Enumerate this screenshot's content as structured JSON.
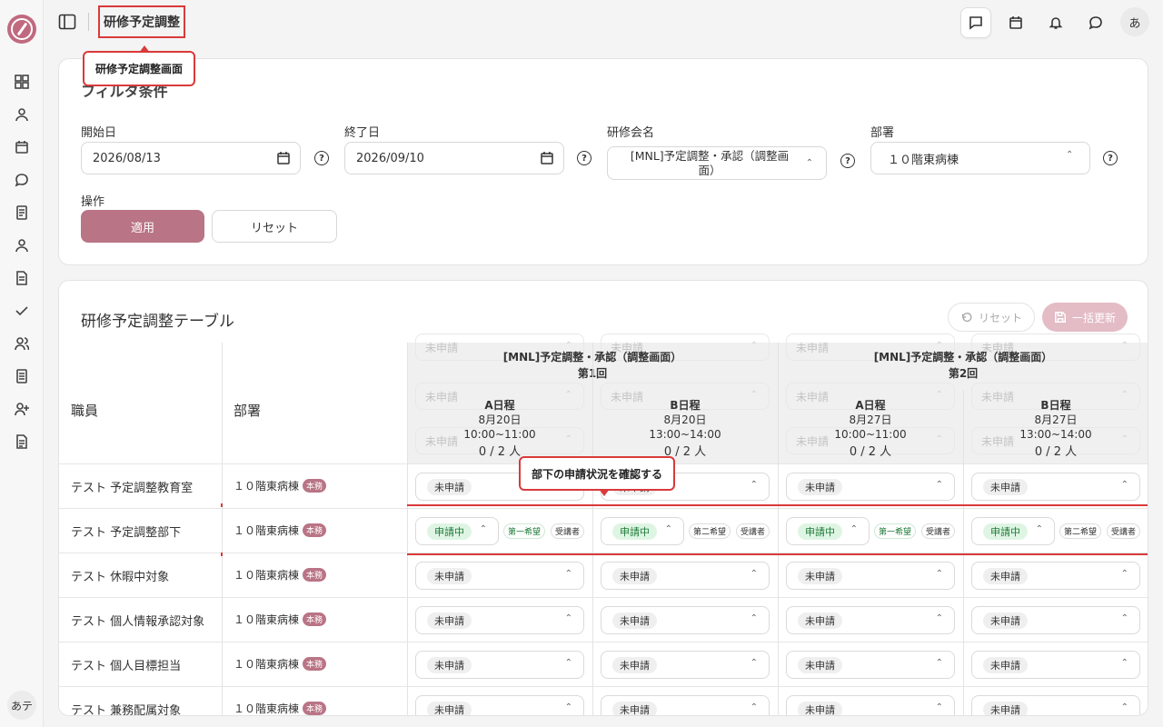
{
  "app": {
    "page_title": "研修予定調整",
    "user_initial": "あ",
    "user_initials_rail": "あテ"
  },
  "callouts": {
    "page": "研修予定調整画面",
    "row": "部下の申請状況を確認する"
  },
  "filter": {
    "title": "フィルタ条件",
    "start_label": "開始日",
    "start_value": "2026/08/13",
    "end_label": "終了日",
    "end_value": "2026/09/10",
    "training_label": "研修会名",
    "training_value": "[MNL]予定調整・承認（調整画面）",
    "dept_label": "部署",
    "dept_value": "１０階東病棟",
    "ops_label": "操作",
    "apply": "適用",
    "reset": "リセット",
    "help": "?"
  },
  "table": {
    "title": "研修予定調整テーブル",
    "reset": "リセット",
    "bulk_update": "一括更新",
    "col_employee": "職員",
    "col_dept": "部署",
    "groups": [
      {
        "title": "[MNL]予定調整・承認（調整画面）",
        "round": "第1回"
      },
      {
        "title": "[MNL]予定調整・承認（調整画面）",
        "round": "第2回"
      }
    ],
    "sessions": [
      {
        "name": "A日程",
        "date": "8月20日",
        "time": "10:00~11:00",
        "capacity": "0 / 2 人"
      },
      {
        "name": "B日程",
        "date": "8月20日",
        "time": "13:00~14:00",
        "capacity": "0 / 2 人"
      },
      {
        "name": "A日程",
        "date": "8月27日",
        "time": "10:00~11:00",
        "capacity": "0 / 2 人"
      },
      {
        "name": "B日程",
        "date": "8月27日",
        "time": "13:00~14:00",
        "capacity": "0 / 2 人"
      }
    ],
    "ghost_status": "未申請",
    "rows": [
      {
        "employee": "テスト 予定調整教育室",
        "dept": "１０階東病棟",
        "badge": "本務",
        "status": [
          "未申請",
          "未申請",
          "未申請",
          "未申請"
        ]
      },
      {
        "employee": "テスト 予定調整部下",
        "dept": "１０階東病棟",
        "badge": "本務",
        "status": [
          "申請中",
          "申請中",
          "申請中",
          "申請中"
        ],
        "prefs": [
          "第一希望",
          "第二希望",
          "第一希望",
          "第二希望"
        ],
        "role": "受講者"
      },
      {
        "employee": "テスト 休暇中対象",
        "dept": "１０階東病棟",
        "badge": "本務",
        "status": [
          "未申請",
          "未申請",
          "未申請",
          "未申請"
        ]
      },
      {
        "employee": "テスト 個人情報承認対象",
        "dept": "１０階東病棟",
        "badge": "本務",
        "status": [
          "未申請",
          "未申請",
          "未申請",
          "未申請"
        ]
      },
      {
        "employee": "テスト 個人目標担当",
        "dept": "１０階東病棟",
        "badge": "本務",
        "status": [
          "未申請",
          "未申請",
          "未申請",
          "未申請"
        ]
      },
      {
        "employee": "テスト 兼務配属対象",
        "dept": "１０階東病棟",
        "badge": "本務",
        "status": [
          "未申請",
          "未申請",
          "未申請",
          "未申請"
        ]
      }
    ]
  },
  "colors": {
    "accent": "#b97485",
    "highlight": "#d93a3a",
    "applying": "#dff5e4"
  }
}
